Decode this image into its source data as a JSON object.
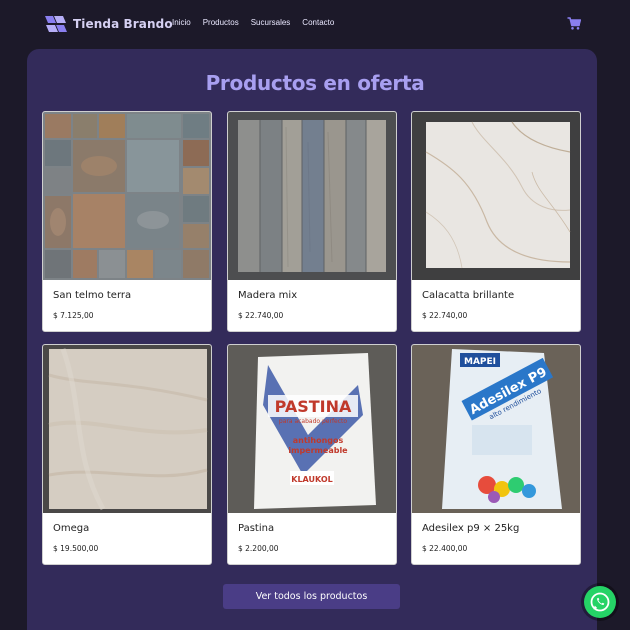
{
  "brand": {
    "name": "Tienda Brando"
  },
  "nav": {
    "links": [
      {
        "label": "Inicio"
      },
      {
        "label": "Productos"
      },
      {
        "label": "Sucursales"
      },
      {
        "label": "Contacto"
      }
    ],
    "cart_icon": "shopping-cart-icon"
  },
  "section": {
    "title": "Productos en oferta"
  },
  "products": [
    {
      "name": "San telmo terra",
      "price": "$ 7.125,00"
    },
    {
      "name": "Madera mix",
      "price": "$ 22.740,00"
    },
    {
      "name": "Calacatta brillante",
      "price": "$ 22.740,00"
    },
    {
      "name": "Omega",
      "price": "$ 19.500,00"
    },
    {
      "name": "Pastina",
      "price": "$ 2.200,00"
    },
    {
      "name": "Adesilex p9 × 25kg",
      "price": "$ 22.400,00"
    }
  ],
  "product_images": {
    "pastina_bag": {
      "brand": "PASTINA",
      "line1": "para acabado perfecto",
      "line2": "antihongos",
      "line3": "impermeable",
      "maker": "KLAUKOL"
    },
    "adesilex_bag": {
      "maker": "MAPEI",
      "brand": "Adesilex P9",
      "line1": "alto rendimiento"
    }
  },
  "cta": {
    "label": "Ver todos los productos"
  },
  "whatsapp": {
    "icon": "whatsapp-icon"
  },
  "colors": {
    "background": "#1c1929",
    "panel": "#332b5a",
    "title": "#a89ff0",
    "button": "#4a3d86",
    "whatsapp": "#25d366"
  }
}
